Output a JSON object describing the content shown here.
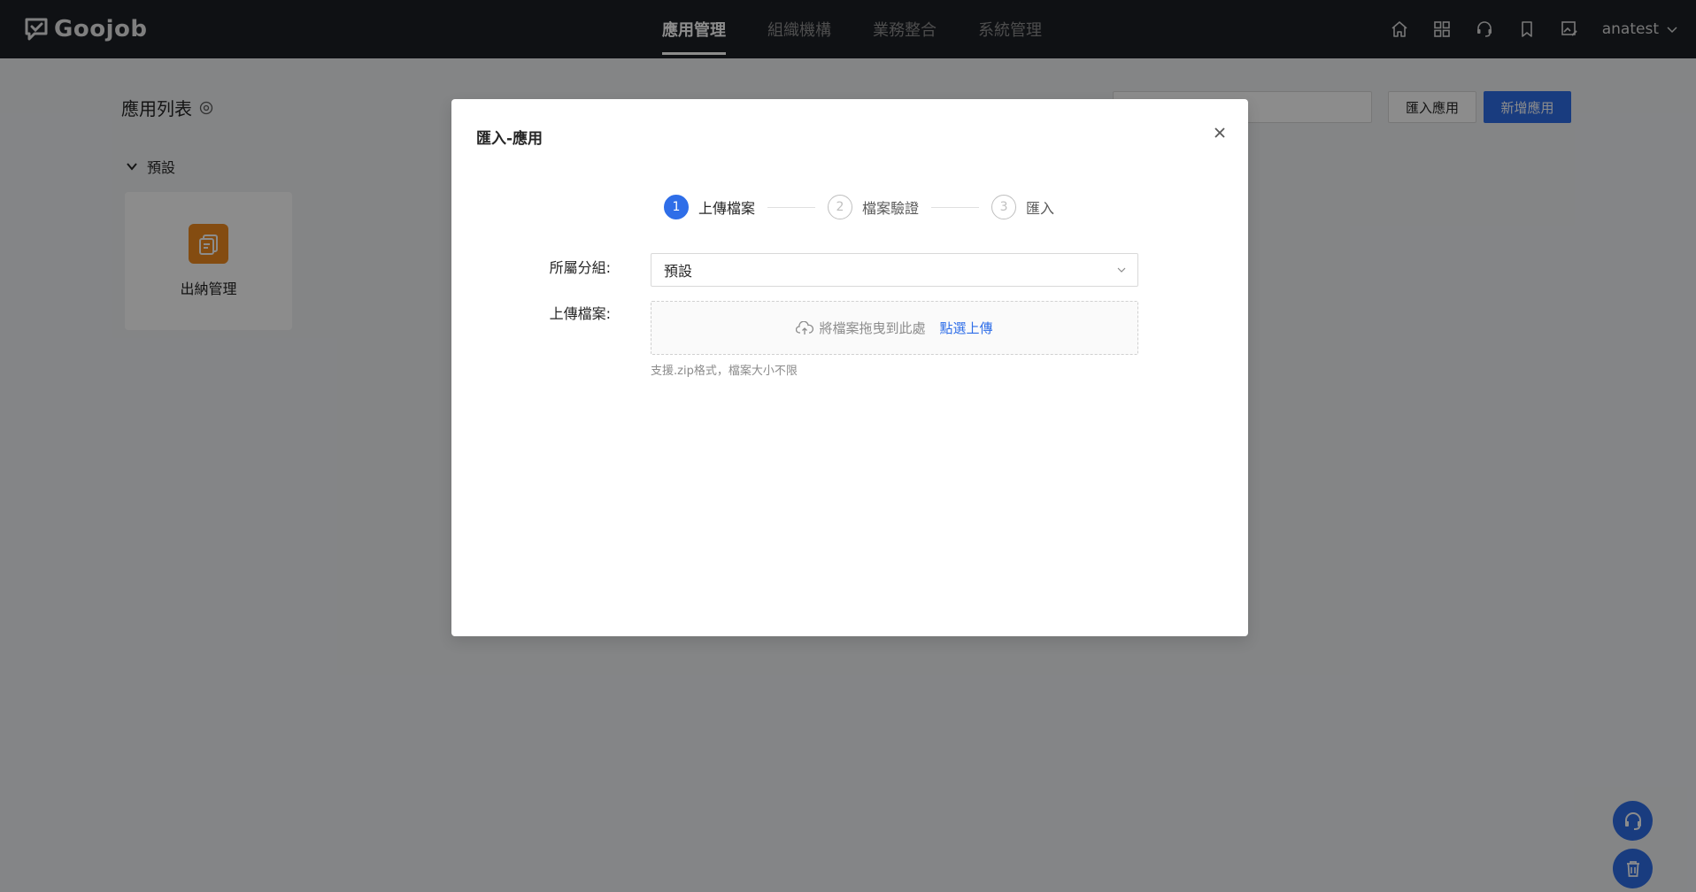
{
  "topbar": {
    "logo_text": "Goojob",
    "nav": [
      {
        "label": "應用管理",
        "active": true
      },
      {
        "label": "組織機構",
        "active": false
      },
      {
        "label": "業務整合",
        "active": false
      },
      {
        "label": "系統管理",
        "active": false
      }
    ],
    "icons": [
      "home-icon",
      "grid-icon",
      "headset-icon",
      "bookmark-icon",
      "image-edit-icon"
    ],
    "user": "anatest"
  },
  "page": {
    "title": "應用列表",
    "group_label": "預設",
    "apps": [
      {
        "name": "出納管理",
        "icon": "document-stack-icon",
        "icon_color": "#f08a1f"
      }
    ],
    "import_button": "匯入應用",
    "new_button": "新增應用"
  },
  "modal": {
    "title": "匯入-應用",
    "steps": [
      {
        "num": "1",
        "label": "上傳檔案",
        "active": true
      },
      {
        "num": "2",
        "label": "檔案驗證",
        "active": false
      },
      {
        "num": "3",
        "label": "匯入",
        "active": false
      }
    ],
    "group_field_label": "所屬分組:",
    "group_value": "預設",
    "upload_field_label": "上傳檔案:",
    "dropzone_text": "將檔案拖曳到此處",
    "dropzone_link": "點選上傳",
    "hint": "支援.zip格式，檔案大小不限"
  },
  "colors": {
    "accent": "#2f6ee8",
    "topbar": "#1c1f26",
    "app_icon": "#f08a1f"
  }
}
